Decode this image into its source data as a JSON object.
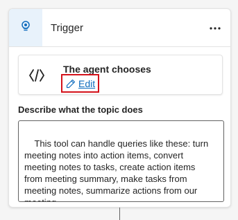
{
  "header": {
    "title": "Trigger",
    "icon": "lightbulb-icon",
    "more_icon": "more-horizontal-icon"
  },
  "trigger_option": {
    "title": "The agent chooses",
    "icon": "agent-logo-icon",
    "edit_label": "Edit",
    "edit_icon": "pencil-icon"
  },
  "description": {
    "label": "Describe what the topic does",
    "value": "This tool can handle queries like these: turn\nmeeting notes into action items, convert\nmeeting notes to tasks, create action items\nfrom meeting summary, make tasks from\nmeeting notes, summarize actions from our\nmeeting"
  },
  "colors": {
    "accent": "#0f6cbd",
    "highlight_border": "#d4111a",
    "icon_bg": "#e8f2fb"
  }
}
